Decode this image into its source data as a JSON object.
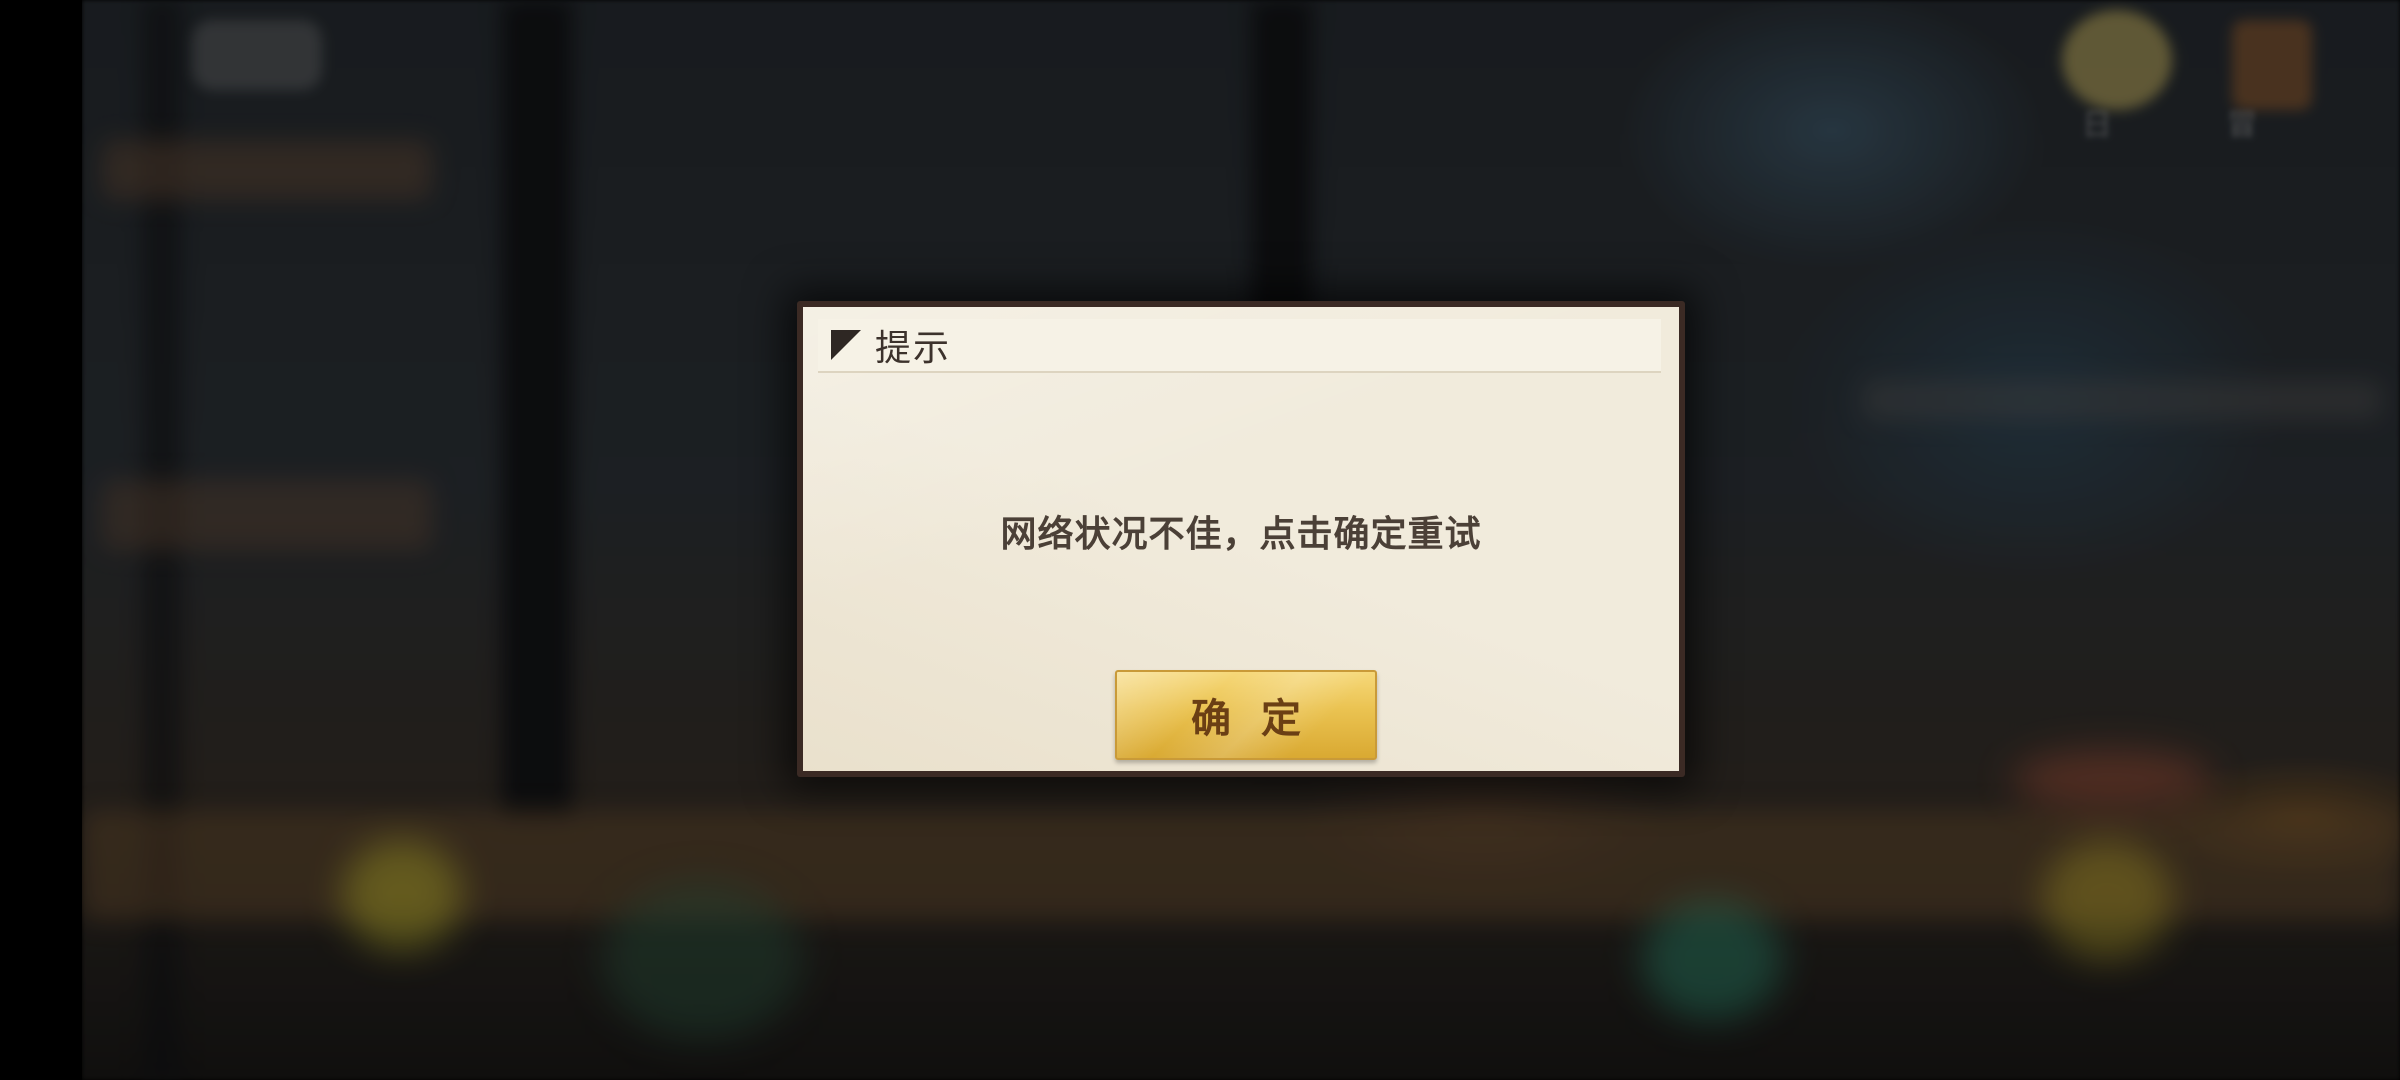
{
  "background": {
    "hud_labels": [
      "日",
      "冒"
    ]
  },
  "dialog": {
    "title": "提示",
    "message": "网络状况不佳，点击确定重试",
    "confirm_label": "确 定"
  },
  "colors": {
    "dialog_frame": "#3b2a24",
    "dialog_body": "#f1ebdc",
    "title_bar": "#f6f2e6",
    "button_gold": "#eac250",
    "button_text": "#6b3f14",
    "text": "#4b4037"
  }
}
